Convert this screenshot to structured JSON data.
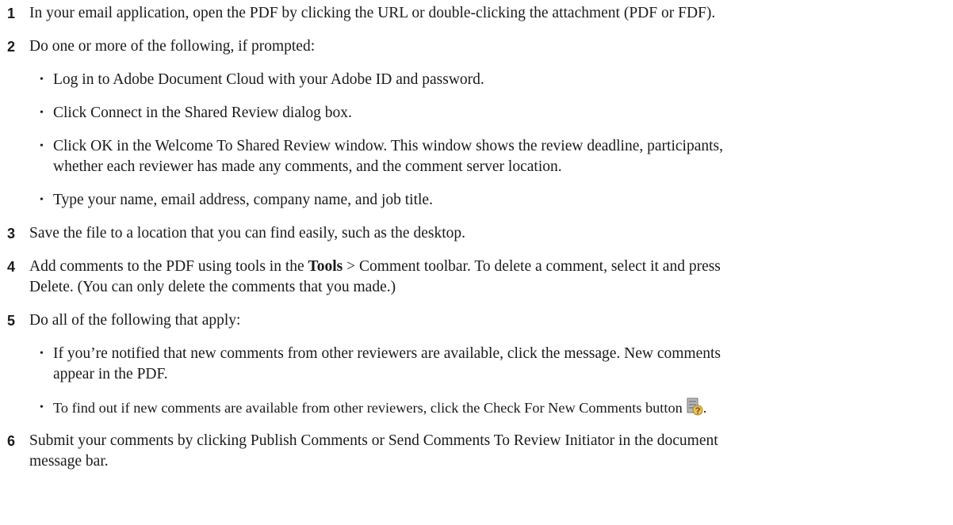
{
  "steps": [
    {
      "number": "1",
      "text": "In your email application, open the PDF by clicking the URL or double-clicking the attachment (PDF or FDF)."
    },
    {
      "number": "2",
      "text": "Do one or more of the following, if prompted:",
      "bullets": [
        "Log in to Adobe Document Cloud with your Adobe ID and password.",
        "Click Connect in the Shared Review dialog box.",
        "Click OK in the Welcome To Shared Review window. This window shows the review deadline, participants,",
        "whether each reviewer has made any comments, and the comment server location.",
        "Type your name, email address, company name, and job title."
      ]
    },
    {
      "number": "3",
      "text": "Save the file to a location that you can find easily, such as the desktop."
    },
    {
      "number": "4",
      "text_before": "Add comments to the PDF using tools in the ",
      "bold": "Tools",
      "text_after": " > Comment toolbar. To delete a comment, select it and press",
      "text_line2": "Delete. (You can only delete the comments that you made.)"
    },
    {
      "number": "5",
      "text": "Do all of the following that apply:",
      "bullets": [
        "If you’re notified that new comments from other reviewers are available, click the message. New comments",
        "appear in the PDF.",
        "To find out if new comments are available from other reviewers, click the Check For New Comments button",
        "."
      ]
    },
    {
      "number": "6",
      "text": "Submit your comments by clicking Publish Comments or Send Comments To Review Initiator in the document",
      "text_line2": "message bar."
    }
  ],
  "bullet_char": "•",
  "icons": {
    "check_new_comments": "check-for-new-comments-icon"
  },
  "colors": {
    "text": "#1a1a1a",
    "icon_gray": "#9a9a9a",
    "icon_yellow": "#e0b23a"
  }
}
